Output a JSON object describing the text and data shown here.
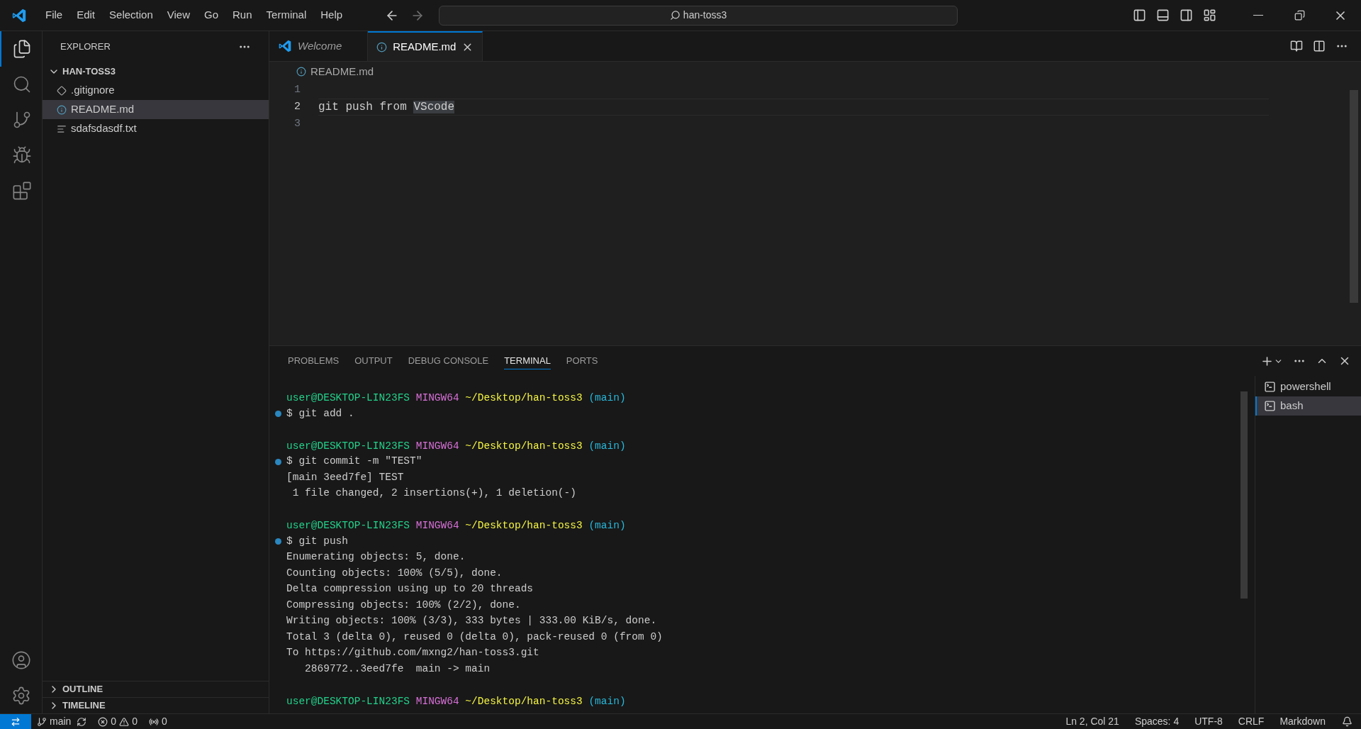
{
  "menu": [
    "File",
    "Edit",
    "Selection",
    "View",
    "Go",
    "Run",
    "Terminal",
    "Help"
  ],
  "command_center": {
    "text": "han-toss3"
  },
  "activity_bar": [
    {
      "kind": "explorer",
      "selected": true
    },
    {
      "kind": "search",
      "selected": false
    },
    {
      "kind": "source_control",
      "selected": false
    },
    {
      "kind": "run",
      "selected": false
    },
    {
      "kind": "extensions",
      "selected": false
    }
  ],
  "sidebar": {
    "title": "EXPLORER",
    "folder": {
      "name": "HAN-TOSS3",
      "expanded": true,
      "children": [
        {
          "name": ".gitignore",
          "kind": "git",
          "selected": false
        },
        {
          "name": "README.md",
          "kind": "info",
          "selected": true
        },
        {
          "name": "sdafsdasdf.txt",
          "kind": "text",
          "selected": false
        }
      ]
    },
    "sections": [
      {
        "name": "OUTLINE",
        "expanded": false
      },
      {
        "name": "TIMELINE",
        "expanded": false
      }
    ]
  },
  "editor": {
    "tabs": [
      {
        "label": "Welcome",
        "kind": "welcome",
        "selected": false
      },
      {
        "label": "README.md",
        "kind": "info",
        "selected": true
      }
    ],
    "breadcrumb": "README.md",
    "lines": [
      {
        "number": "1",
        "current": false
      },
      {
        "number": "2",
        "text": "git push from ",
        "highlight": "VScode",
        "current": true
      },
      {
        "number": "3",
        "current": false
      }
    ]
  },
  "panel": {
    "tabs": [
      {
        "label": "PROBLEMS",
        "selected": false
      },
      {
        "label": "OUTPUT",
        "selected": false
      },
      {
        "label": "DEBUG CONSOLE",
        "selected": false
      },
      {
        "label": "TERMINAL",
        "selected": true
      },
      {
        "label": "PORTS",
        "selected": false
      }
    ],
    "terminal_lines": [
      {
        "kind": "prompt",
        "user": "user@DESKTOP-LIN23FS",
        "system": "MINGW64",
        "path": "~/Desktop/han-toss3",
        "branch": "(main)"
      },
      {
        "kind": "command",
        "text": "$ git add ."
      },
      {
        "kind": "blank"
      },
      {
        "kind": "prompt",
        "user": "user@DESKTOP-LIN23FS",
        "system": "MINGW64",
        "path": "~/Desktop/han-toss3",
        "branch": "(main)"
      },
      {
        "kind": "command",
        "text": "$ git commit -m \"TEST\""
      },
      {
        "kind": "output",
        "text": "[main 3eed7fe] TEST"
      },
      {
        "kind": "output",
        "text": " 1 file changed, 2 insertions(+), 1 deletion(-)"
      },
      {
        "kind": "blank"
      },
      {
        "kind": "prompt",
        "user": "user@DESKTOP-LIN23FS",
        "system": "MINGW64",
        "path": "~/Desktop/han-toss3",
        "branch": "(main)"
      },
      {
        "kind": "command",
        "text": "$ git push"
      },
      {
        "kind": "output",
        "text": "Enumerating objects: 5, done."
      },
      {
        "kind": "output",
        "text": "Counting objects: 100% (5/5), done."
      },
      {
        "kind": "output",
        "text": "Delta compression using up to 20 threads"
      },
      {
        "kind": "output",
        "text": "Compressing objects: 100% (2/2), done."
      },
      {
        "kind": "output",
        "text": "Writing objects: 100% (3/3), 333 bytes | 333.00 KiB/s, done."
      },
      {
        "kind": "output",
        "text": "Total 3 (delta 0), reused 0 (delta 0), pack-reused 0 (from 0)"
      },
      {
        "kind": "output",
        "text": "To https://github.com/mxng2/han-toss3.git"
      },
      {
        "kind": "output",
        "text": "   2869772..3eed7fe  main -> main"
      },
      {
        "kind": "blank"
      },
      {
        "kind": "prompt",
        "user": "user@DESKTOP-LIN23FS",
        "system": "MINGW64",
        "path": "~/Desktop/han-toss3",
        "branch": "(main)"
      }
    ],
    "terminals": [
      {
        "name": "powershell",
        "selected": false
      },
      {
        "name": "bash",
        "selected": true
      }
    ]
  },
  "status_bar": {
    "branch": "main",
    "errors": "0",
    "warnings": "0",
    "ports": "0",
    "items": [
      "Ln 2, Col 21",
      "Spaces: 4",
      "UTF-8",
      "CRLF",
      "Markdown"
    ]
  }
}
